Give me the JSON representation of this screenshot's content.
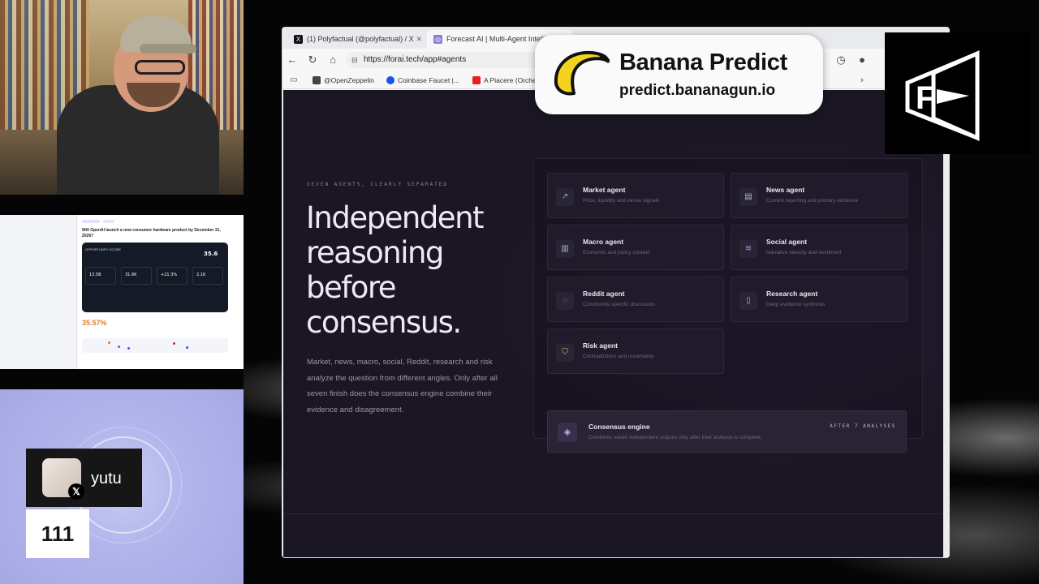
{
  "browser": {
    "tabs": [
      {
        "label": "(1) Polyfactual (@polyfactual) / X",
        "icon": "x-logo-icon"
      },
      {
        "label": "Forecast AI | Multi-Agent Intelli",
        "icon": "forecast-icon"
      }
    ],
    "url": "https://forai.tech/app#agents",
    "bookmarks": [
      "@OpenZeppelin",
      "Coinbase Faucet |...",
      "A Piacere (Orche"
    ]
  },
  "hero": {
    "eyebrow": "SEVEN AGENTS, CLEARLY SEPARATED",
    "headline": "Independent reasoning before consensus.",
    "description": "Market, news, macro, social, Reddit, research and risk analyze the question from different angles. Only after all seven finish does the consensus engine combine their evidence and disagreement."
  },
  "agents": [
    {
      "title": "Market agent",
      "desc": "Price, liquidity and venue signals",
      "icon": "chart-icon"
    },
    {
      "title": "News agent",
      "desc": "Current reporting and primary evidence",
      "icon": "newspaper-icon"
    },
    {
      "title": "Macro agent",
      "desc": "Economic and policy context",
      "icon": "bar-chart-icon"
    },
    {
      "title": "Social agent",
      "desc": "Narrative velocity and sentiment",
      "icon": "waves-icon"
    },
    {
      "title": "Reddit agent",
      "desc": "Community-specific discussion",
      "icon": "chat-bubble-icon"
    },
    {
      "title": "Research agent",
      "desc": "Deep evidence synthesis",
      "icon": "book-icon"
    },
    {
      "title": "Risk agent",
      "desc": "Contradictions and uncertainty",
      "icon": "shield-icon"
    }
  ],
  "consensus": {
    "title": "Consensus engine",
    "desc": "Combines seven independent outputs only after their analysis is complete.",
    "tag": "AFTER 7 ANALYSES",
    "icon": "layers-icon"
  },
  "overlay": {
    "brand_name": "Banana Predict",
    "brand_url": "predict.bananagun.io"
  },
  "thumbnail": {
    "question": "Will OpenAI launch a new consumer hardware product by December 31, 2026?",
    "score": "35.6",
    "stats": [
      "13.5B",
      "31.6K",
      "+21.3%",
      "2.1K"
    ],
    "percent": "35.57%"
  },
  "user": {
    "name": "yutu",
    "count": "111"
  }
}
